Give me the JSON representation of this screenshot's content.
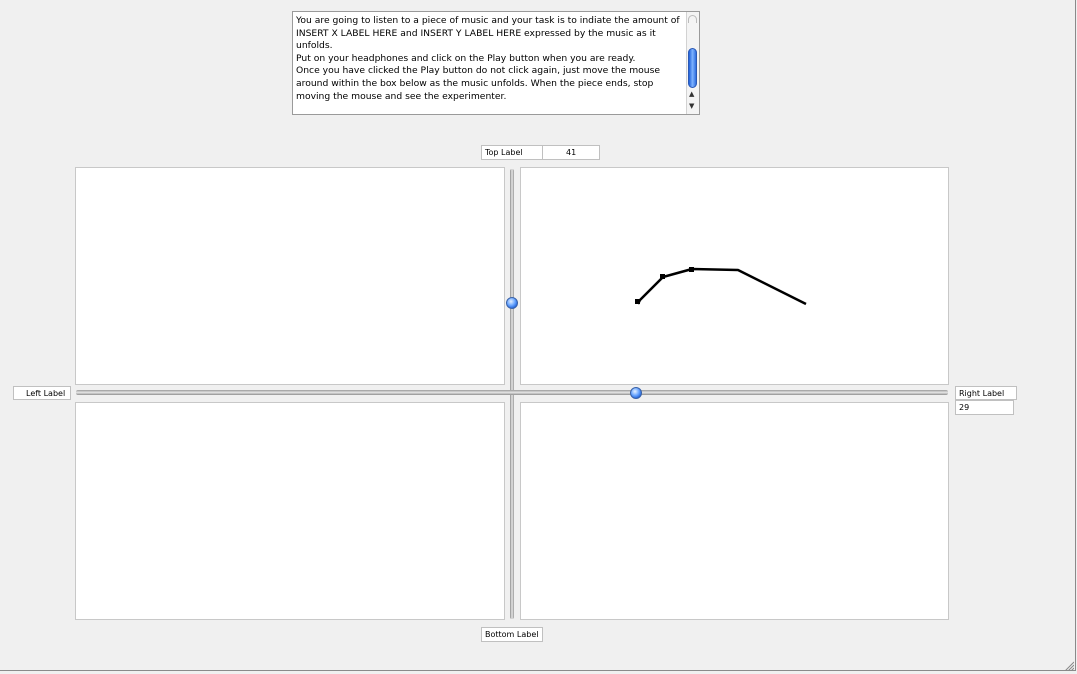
{
  "instructions": {
    "line1": "You are going to listen to a piece of music and your task is to indiate the amount of INSERT X LABEL HERE and INSERT Y LABEL HERE expressed by the music as it unfolds.",
    "line2": "Put on your headphones and click on the Play button when you are ready.",
    "line3": "Once you have clicked the Play button do not click again, just move the mouse around within the box below as the music unfolds.  When the piece ends, stop moving the mouse and see the experimenter."
  },
  "scrollbar": {
    "up_glyph": "▲",
    "down_glyph": "▼"
  },
  "labels": {
    "top": "Top Label",
    "top_value": "41",
    "bottom": "Bottom Label",
    "left": "Left Label",
    "right": "Right Label",
    "right_value": "29"
  },
  "trace": {
    "color": "#000000"
  },
  "accent": {
    "knob": "#1d5fd8"
  }
}
